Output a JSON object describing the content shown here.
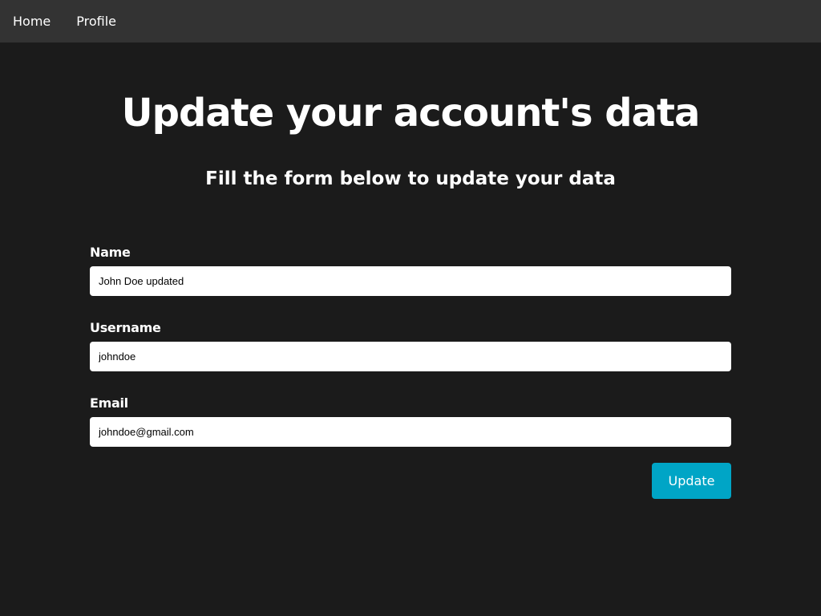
{
  "nav": {
    "items": [
      {
        "label": "Home"
      },
      {
        "label": "Profile"
      }
    ]
  },
  "main": {
    "title": "Update your account's data",
    "subtitle": "Fill the form below to update your data"
  },
  "form": {
    "name": {
      "label": "Name",
      "value": "John Doe updated"
    },
    "username": {
      "label": "Username",
      "value": "johndoe"
    },
    "email": {
      "label": "Email",
      "value": "johndoe@gmail.com"
    },
    "submit_label": "Update"
  },
  "colors": {
    "background": "#1b1b1b",
    "navbar": "#333333",
    "accent": "#00a5c6"
  }
}
